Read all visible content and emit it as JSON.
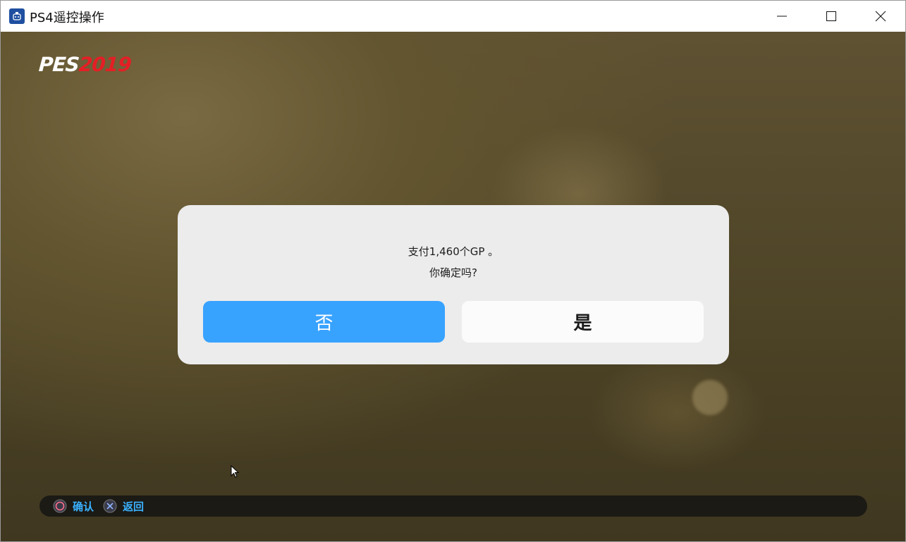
{
  "window": {
    "title": "PS4遥控操作",
    "app_icon": "ps4-remote-icon",
    "controls": [
      "minimize-icon",
      "maximize-icon",
      "close-icon"
    ]
  },
  "game": {
    "logo": {
      "pes": "PES",
      "year": "2019"
    },
    "dialog": {
      "message_line1": "支付1,460个GP 。",
      "message_line2": "你确定吗?",
      "no_label": "否",
      "yes_label": "是"
    },
    "hint_bar": {
      "confirm_label": "确认",
      "confirm_icon": "circle-button-icon",
      "back_label": "返回",
      "back_icon": "cross-button-icon"
    }
  },
  "colors": {
    "accent_blue": "#38a2ff",
    "logo_red": "#e41f25",
    "hint_text": "#3ab2ff"
  }
}
